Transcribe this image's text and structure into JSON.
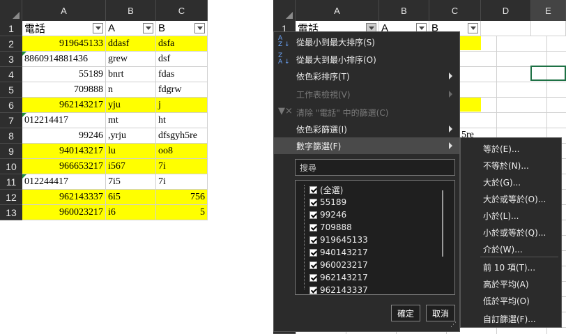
{
  "left_sheet": {
    "columns": [
      "A",
      "B",
      "C"
    ],
    "rows": [
      {
        "n": "1",
        "a": "電話",
        "b": "A",
        "c": "B",
        "header": true
      },
      {
        "n": "2",
        "a": "919645133",
        "b": "ddasf",
        "c": "dsfa",
        "y": true
      },
      {
        "n": "3",
        "a": "8860914881436",
        "b": "grew",
        "c": "dsf",
        "tri": true,
        "atext": true
      },
      {
        "n": "4",
        "a": "55189",
        "b": "bnrt",
        "c": "fdas"
      },
      {
        "n": "5",
        "a": "709888",
        "b": "n",
        "c": "fdgrw"
      },
      {
        "n": "6",
        "a": "962143217",
        "b": "yju",
        "c": "j",
        "y": true
      },
      {
        "n": "7",
        "a": "012214417",
        "b": "mt",
        "c": "ht",
        "tri": true,
        "atext": true
      },
      {
        "n": "8",
        "a": "99246",
        "b": ",yrju",
        "c": "dfsgyh5re"
      },
      {
        "n": "9",
        "a": "940143217",
        "b": "lu",
        "c": "oo8",
        "y": true
      },
      {
        "n": "10",
        "a": "966653217",
        "b": "i567",
        "c": "7i",
        "y": true
      },
      {
        "n": "11",
        "a": "012244417",
        "b": "7i5",
        "c": "7i",
        "tri": true,
        "atext": true
      },
      {
        "n": "12",
        "a": "962143337",
        "b": "6i5",
        "c": "756",
        "y": true,
        "cnum": true
      },
      {
        "n": "13",
        "a": "960023217",
        "b": "i6",
        "c": "5",
        "y": true,
        "cnum": true
      }
    ]
  },
  "right_sheet": {
    "columns": [
      "A",
      "B",
      "C",
      "D",
      "E"
    ],
    "row1": {
      "a": "電話",
      "b": "A",
      "c": "B"
    },
    "row_numbers": [
      "1",
      "2"
    ],
    "peek_text": "5re"
  },
  "dropdown": {
    "sort_asc": "從最小到最大排序(S)",
    "sort_desc": "從最大到最小排序(O)",
    "sort_color": "依色彩排序(T)",
    "sheet_view": "工作表檢視(V)",
    "clear_filter": "清除 \"電話\" 中的篩選(C)",
    "filter_color": "依色彩篩選(I)",
    "number_filter": "數字篩選(F)",
    "search_placeholder": "搜尋",
    "list": [
      "(全選)",
      "55189",
      "99246",
      "709888",
      "919645133",
      "940143217",
      "960023217",
      "962143217",
      "962143337"
    ],
    "ok": "確定",
    "cancel": "取消"
  },
  "submenu": {
    "items": [
      "等於(E)...",
      "不等於(N)...",
      "大於(G)...",
      "大於或等於(O)...",
      "小於(L)...",
      "小於或等於(Q)...",
      "介於(W)...",
      "前 10 項(T)...",
      "高於平均(A)",
      "低於平均(O)",
      "自訂篩選(F)..."
    ]
  },
  "colors": {
    "highlight": "#ffff00",
    "menu_bg": "#2b2b2b",
    "header_bg": "#2e2e2e"
  }
}
